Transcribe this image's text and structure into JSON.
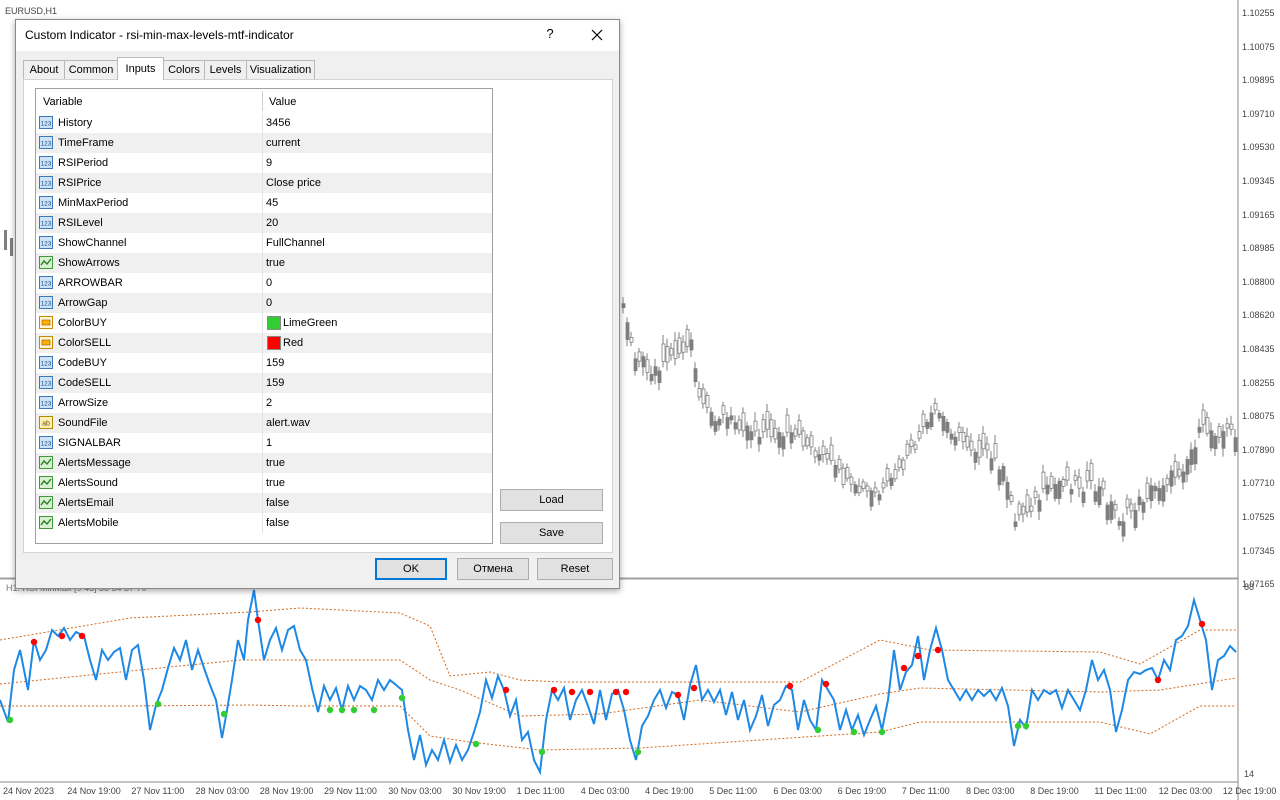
{
  "chart": {
    "symbol": "EURUSD,H1",
    "indicator_label": "H1: RSI MinMax [9 45]  38 54 37 70",
    "price_scale": [
      "1.10255",
      "1.10075",
      "1.09895",
      "1.09710",
      "1.09530",
      "1.09345",
      "1.09165",
      "1.08985",
      "1.08800",
      "1.08620",
      "1.08435",
      "1.08255",
      "1.08075",
      "1.07890",
      "1.07710",
      "1.07525",
      "1.07345",
      "1.07165"
    ],
    "indicator_scale": [
      "88",
      "14"
    ],
    "time_axis": [
      "24 Nov 2023",
      "24 Nov 19:00",
      "27 Nov 11:00",
      "28 Nov 03:00",
      "28 Nov 19:00",
      "29 Nov 11:00",
      "30 Nov 03:00",
      "30 Nov 19:00",
      "1 Dec 11:00",
      "4 Dec 03:00",
      "4 Dec 19:00",
      "5 Dec 11:00",
      "6 Dec 03:00",
      "6 Dec 19:00",
      "7 Dec 11:00",
      "8 Dec 03:00",
      "8 Dec 19:00",
      "11 Dec 11:00",
      "12 Dec 03:00",
      "12 Dec 19:00"
    ],
    "colors": {
      "rsi_line": "#1e88e5",
      "channel": "#d2691e",
      "buy_arrow": "#32cd32",
      "sell_arrow": "#ff0000",
      "candle": "#7f7f7f"
    }
  },
  "dialog": {
    "title": "Custom Indicator - rsi-min-max-levels-mtf-indicator",
    "help_label": "?",
    "tabs": [
      "About",
      "Common",
      "Inputs",
      "Colors",
      "Levels",
      "Visualization"
    ],
    "active_tab": "Inputs",
    "columns": {
      "variable": "Variable",
      "value": "Value"
    },
    "params": [
      {
        "name": "History",
        "value": "3456",
        "icon": "int-icon"
      },
      {
        "name": "TimeFrame",
        "value": "current",
        "icon": "int-icon"
      },
      {
        "name": "RSIPeriod",
        "value": "9",
        "icon": "int-icon"
      },
      {
        "name": "RSIPrice",
        "value": "Close price",
        "icon": "int-icon"
      },
      {
        "name": "MinMaxPeriod",
        "value": "45",
        "icon": "int-icon"
      },
      {
        "name": "RSILevel",
        "value": "20",
        "icon": "int-icon"
      },
      {
        "name": "ShowChannel",
        "value": "FullChannel",
        "icon": "int-icon"
      },
      {
        "name": "ShowArrows",
        "value": "true",
        "icon": "bool-icon"
      },
      {
        "name": "ARROWBAR",
        "value": "0",
        "icon": "int-icon"
      },
      {
        "name": "ArrowGap",
        "value": "0",
        "icon": "int-icon"
      },
      {
        "name": "ColorBUY",
        "value": "LimeGreen",
        "icon": "color-icon",
        "swatch": "#32cd32"
      },
      {
        "name": "ColorSELL",
        "value": "Red",
        "icon": "color-icon",
        "swatch": "#ff0000"
      },
      {
        "name": "CodeBUY",
        "value": "159",
        "icon": "int-icon"
      },
      {
        "name": "CodeSELL",
        "value": "159",
        "icon": "int-icon"
      },
      {
        "name": "ArrowSize",
        "value": "2",
        "icon": "int-icon"
      },
      {
        "name": "SoundFile",
        "value": "alert.wav",
        "icon": "string-icon"
      },
      {
        "name": "SIGNALBAR",
        "value": "1",
        "icon": "int-icon"
      },
      {
        "name": "AlertsMessage",
        "value": "true",
        "icon": "bool-icon"
      },
      {
        "name": "AlertsSound",
        "value": "true",
        "icon": "bool-icon"
      },
      {
        "name": "AlertsEmail",
        "value": "false",
        "icon": "bool-icon"
      },
      {
        "name": "AlertsMobile",
        "value": "false",
        "icon": "bool-icon"
      }
    ],
    "buttons": {
      "load": "Load",
      "save": "Save",
      "ok": "OK",
      "cancel": "Отмена",
      "reset": "Reset"
    }
  }
}
